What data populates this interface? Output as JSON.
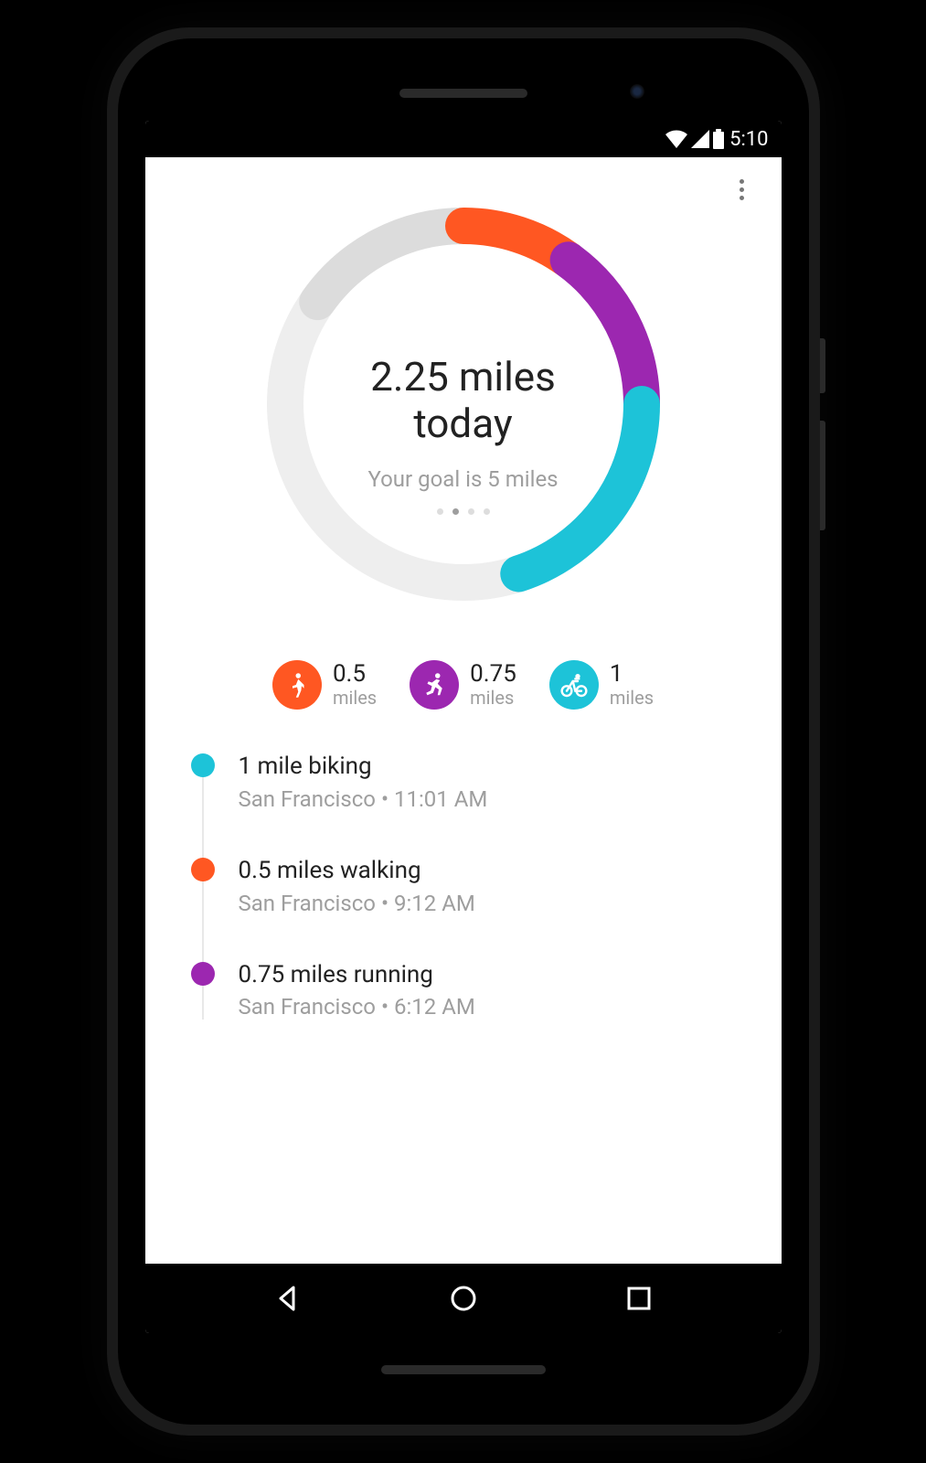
{
  "status": {
    "time": "5:10"
  },
  "ring": {
    "title_line1": "2.25 miles",
    "title_line2": "today",
    "subtitle": "Your goal is 5 miles",
    "goal_miles": 5,
    "total_miles": 2.25,
    "page_indicator": {
      "count": 4,
      "active": 1
    }
  },
  "colors": {
    "walking": "#ff5722",
    "running": "#9c27b0",
    "biking": "#1dc3d8",
    "track_light": "#eeeeee",
    "track_mid": "#dcdcdc"
  },
  "chart_data": {
    "type": "pie",
    "title": "Daily distance progress toward goal",
    "series": [
      {
        "name": "walking",
        "value": 0.5,
        "color": "#ff5722"
      },
      {
        "name": "running",
        "value": 0.75,
        "color": "#9c27b0"
      },
      {
        "name": "biking",
        "value": 1.0,
        "color": "#1dc3d8"
      },
      {
        "name": "remaining",
        "value": 2.75,
        "color": "#eeeeee"
      }
    ],
    "total": 5,
    "unit": "miles"
  },
  "summaries": [
    {
      "activity": "walking",
      "icon": "walk-icon",
      "value": "0.5",
      "unit": "miles",
      "color": "#ff5722"
    },
    {
      "activity": "running",
      "icon": "run-icon",
      "value": "0.75",
      "unit": "miles",
      "color": "#9c27b0"
    },
    {
      "activity": "biking",
      "icon": "bike-icon",
      "value": "1",
      "unit": "miles",
      "color": "#1dc3d8"
    }
  ],
  "timeline": [
    {
      "title": "1 mile biking",
      "location": "San Francisco",
      "time": "11:01 AM",
      "color": "#1dc3d8"
    },
    {
      "title": "0.5 miles walking",
      "location": "San Francisco",
      "time": "9:12 AM",
      "color": "#ff5722"
    },
    {
      "title": "0.75 miles running",
      "location": "San Francisco",
      "time": "6:12 AM",
      "color": "#9c27b0"
    }
  ]
}
